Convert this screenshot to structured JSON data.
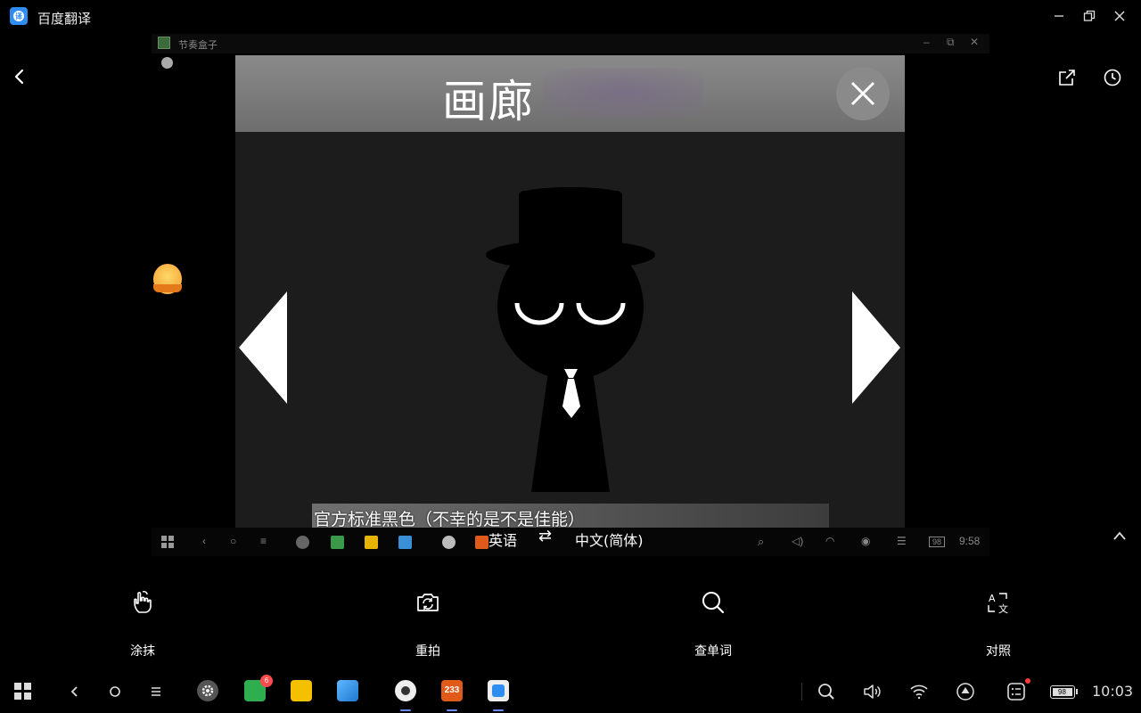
{
  "window": {
    "title": "百度翻译",
    "controls": [
      "minimize-icon",
      "restore-icon",
      "close-icon"
    ]
  },
  "photo": {
    "inner_window_title": "节奏盒子",
    "gallery_title": "画廊",
    "inner_clock": "9:58",
    "inner_battery": "98"
  },
  "translation": {
    "text": "官方标准黑色（不幸的是不是佳能）",
    "source_lang": "英语",
    "target_lang": "中文(简体)",
    "swap_icon": "swap-icon"
  },
  "actions": [
    {
      "label": "涂抹",
      "icon": "hand-smear-icon"
    },
    {
      "label": "重拍",
      "icon": "retake-camera-icon"
    },
    {
      "label": "查单词",
      "icon": "search-icon"
    },
    {
      "label": "对照",
      "icon": "compare-icon"
    }
  ],
  "taskbar": {
    "clock": "10:03",
    "battery": "98",
    "badge_count": "6",
    "app_233_label": "233"
  },
  "colors": {
    "accent": "#2f8cf0",
    "background": "#000000",
    "badge": "#ff4b4b"
  }
}
